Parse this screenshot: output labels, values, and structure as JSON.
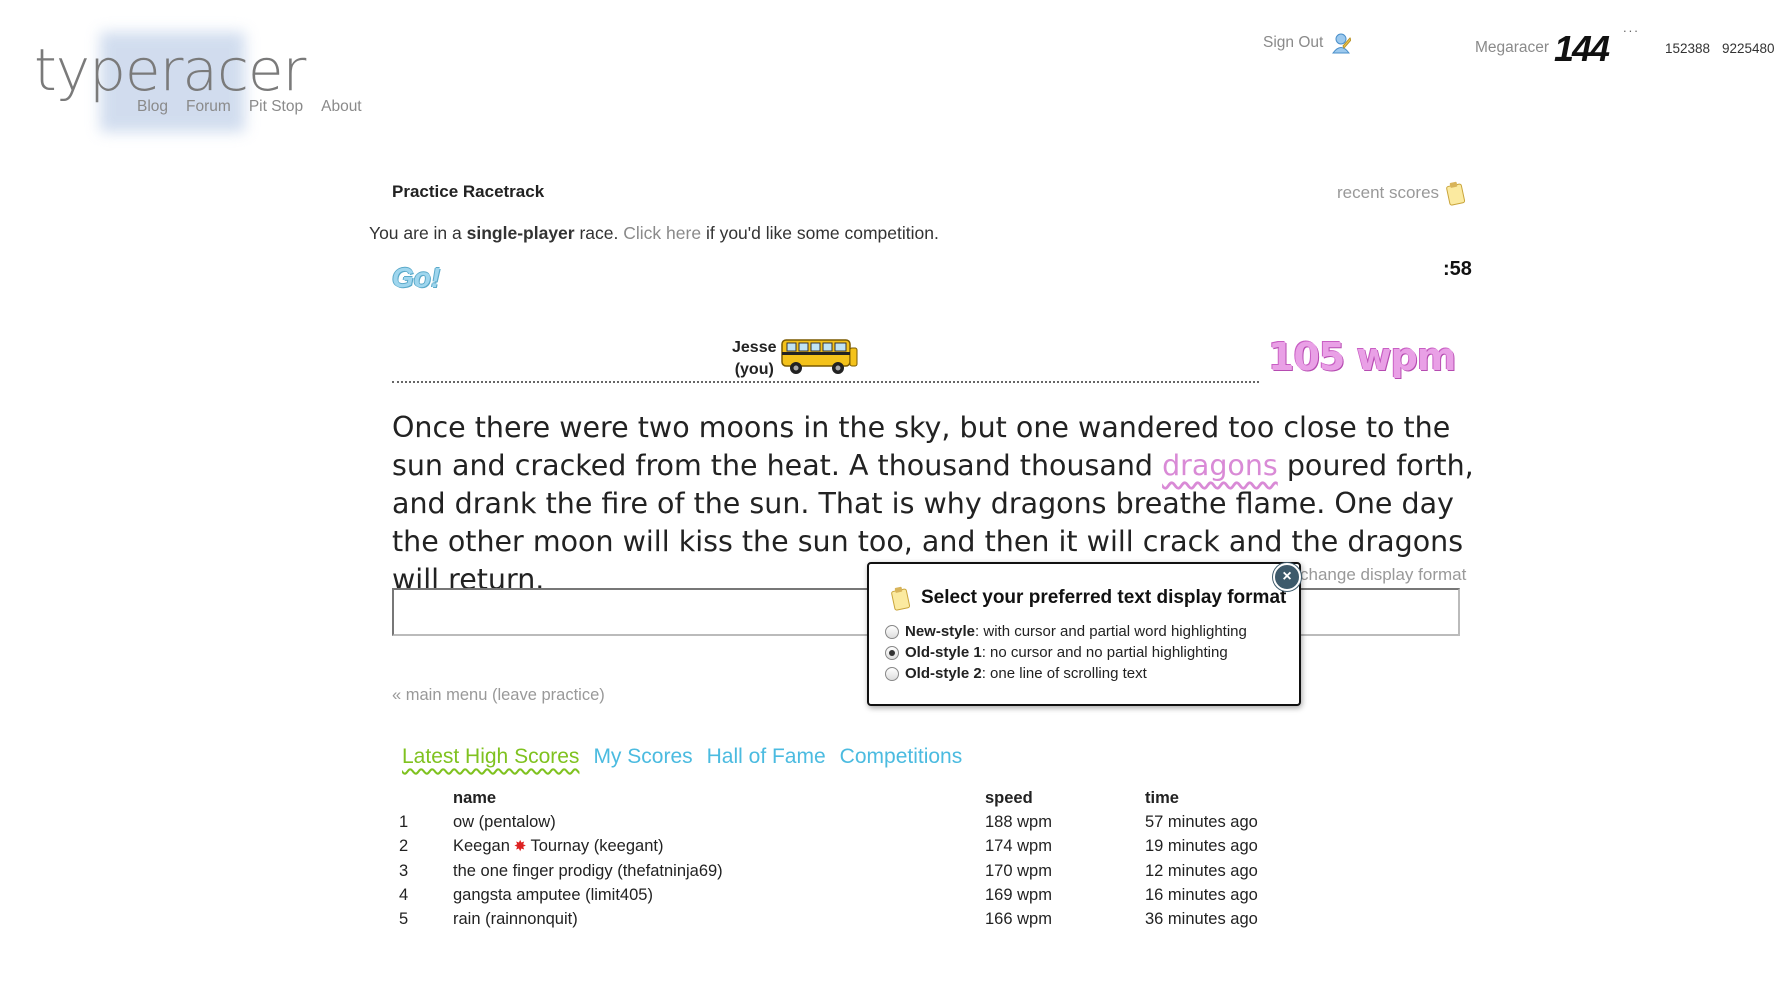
{
  "header": {
    "logo": "typeracer",
    "nav": [
      "Blog",
      "Forum",
      "Pit Stop",
      "About"
    ],
    "sign_out": "Sign Out",
    "username": "Megaracer",
    "rank": "144",
    "rank_dots": "...",
    "stat1": "152388",
    "stat2": "9225480"
  },
  "race": {
    "title": "Practice Racetrack",
    "recent_scores": "recent scores",
    "intro_prefix": "You are in a",
    "intro_bold": "single-player",
    "intro_mid": "race.",
    "intro_link": "Click here",
    "intro_suffix": "if you'd like some competition.",
    "go": "Go!",
    "timer": ":58",
    "racer_name": "Jesse",
    "racer_you": "(you)",
    "wpm": "105 wpm",
    "passage_before": "Once there were two moons in the sky, but one wandered too close to the sun and cracked from the heat. A thousand thousand ",
    "passage_current": "dragons",
    "passage_after": " poured forth, and drank the fire of the sun. That is why dragons breathe flame. One day the other moon will kiss the sun too, and then it will crack and the dragons will return.",
    "change_format": "change display format",
    "main_menu": "« main menu (leave practice)"
  },
  "format_popup": {
    "title": "Select your preferred text display format",
    "close": "×",
    "options": [
      {
        "name": "New-style",
        "desc": ": with cursor and partial word highlighting",
        "selected": false
      },
      {
        "name": "Old-style 1",
        "desc": ": no cursor and no partial highlighting",
        "selected": true
      },
      {
        "name": "Old-style 2",
        "desc": ": one line of scrolling text",
        "selected": false
      }
    ]
  },
  "tabs": [
    "Latest High Scores",
    "My Scores",
    "Hall of Fame",
    "Competitions"
  ],
  "scores": {
    "headers": {
      "name": "name",
      "speed": "speed",
      "time": "time"
    },
    "rows": [
      {
        "rank": "1",
        "name": "ow (pentalow)",
        "speed": "188 wpm",
        "time": "57 minutes ago"
      },
      {
        "rank": "2",
        "name_a": "Keegan",
        "name_b": "Tournay (keegant)",
        "speed": "174 wpm",
        "time": "19 minutes ago"
      },
      {
        "rank": "3",
        "name": "the one finger prodigy (thefatninja69)",
        "speed": "170 wpm",
        "time": "12 minutes ago"
      },
      {
        "rank": "4",
        "name": "gangsta amputee (limit405)",
        "speed": "169 wpm",
        "time": "16 minutes ago"
      },
      {
        "rank": "5",
        "name": "rain (rainnonquit)",
        "speed": "166 wpm",
        "time": "36 minutes ago"
      }
    ]
  },
  "colors": {
    "accent_link": "#4bbbe0",
    "active_tab": "#7fc21f",
    "wpm": "#e9a0e6",
    "highlight_word": "#d98ad6"
  }
}
